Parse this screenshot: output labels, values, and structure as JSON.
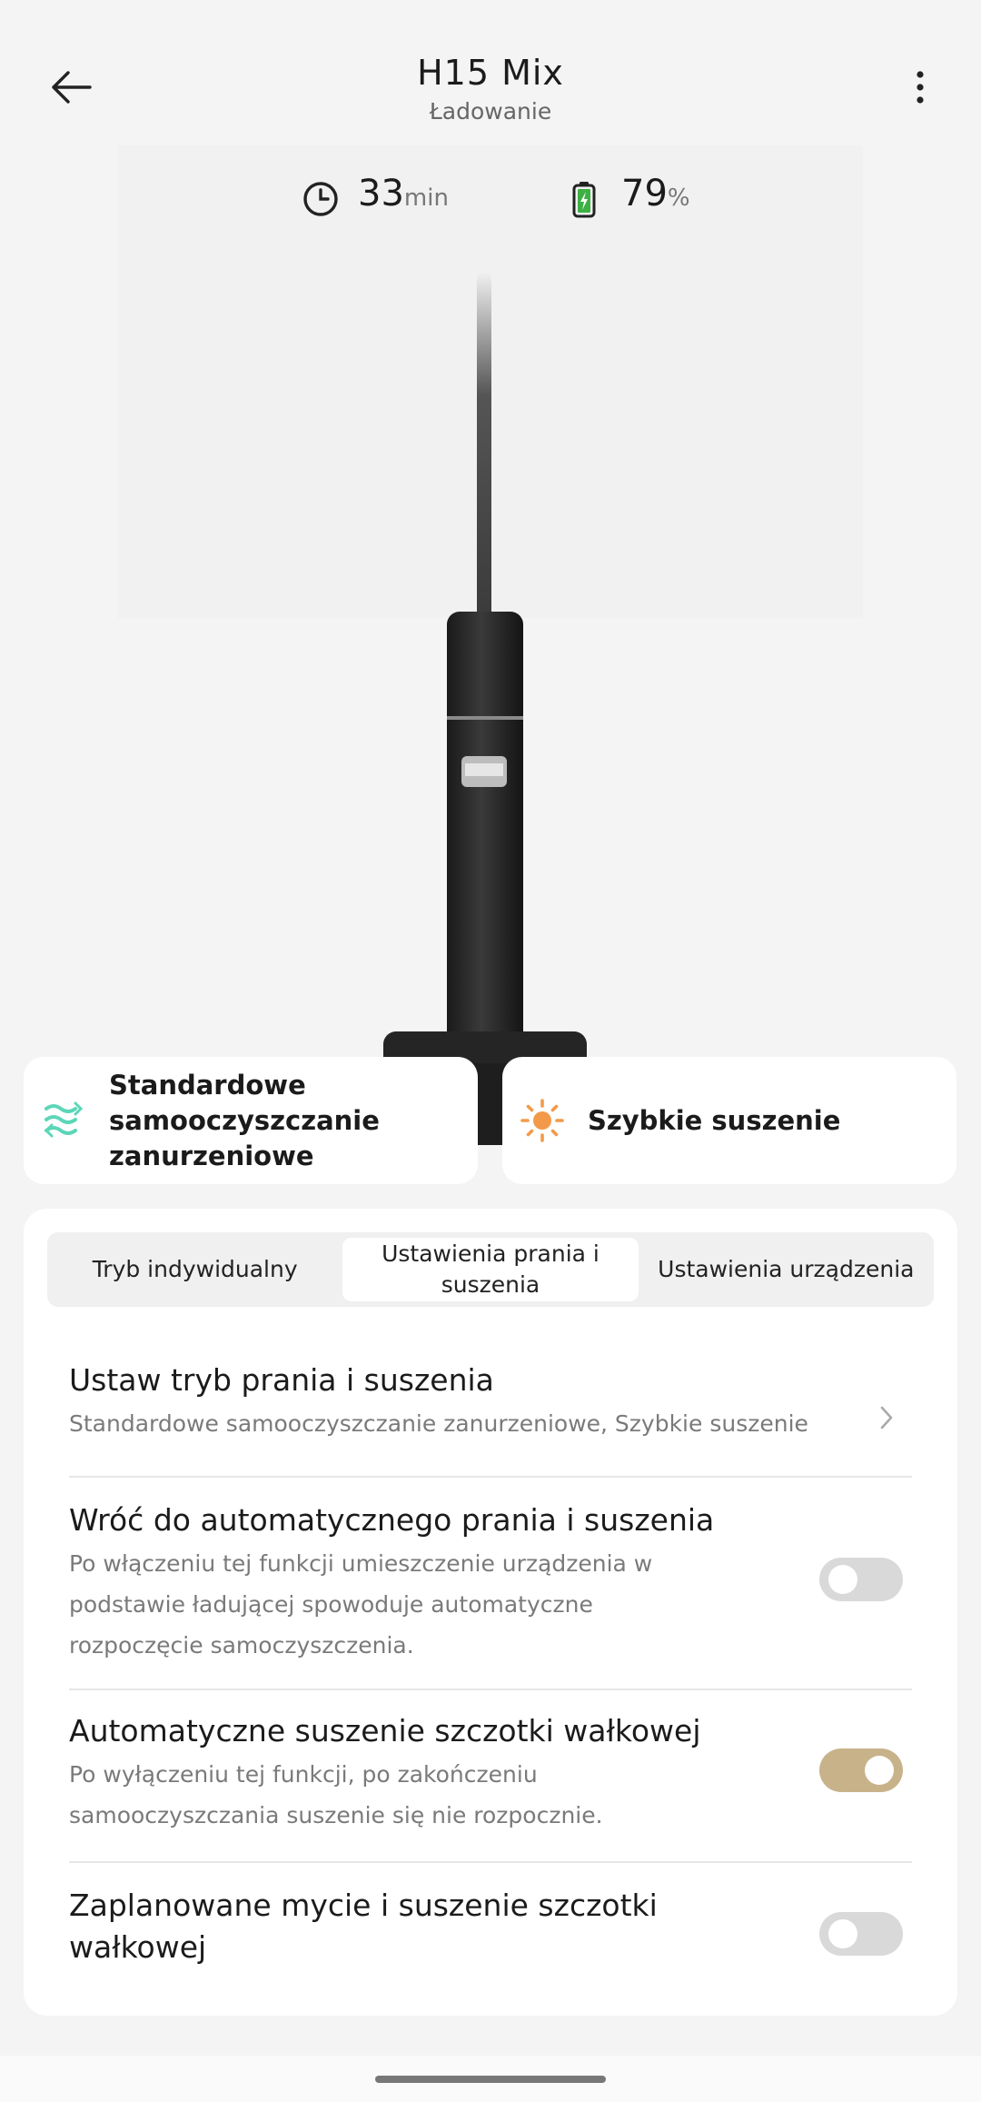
{
  "header": {
    "title": "H15 Mix",
    "status": "Ładowanie",
    "back_icon": "arrow-left-icon",
    "more_icon": "more-vertical-icon"
  },
  "stats": {
    "time_value": "33",
    "time_unit": "min",
    "battery_value": "79",
    "battery_unit": "%",
    "battery_color": "#3cb043"
  },
  "modes": {
    "left": {
      "label": "Standardowe samooczyszczanie zanurzeniowe",
      "icon": "self-clean-wave-icon",
      "color": "#5cd6b8"
    },
    "right": {
      "label": "Szybkie suszenie",
      "icon": "sun-icon",
      "color": "#f29a4a"
    }
  },
  "tabs": [
    {
      "label": "Tryb indywidualny",
      "active": false
    },
    {
      "label": "Ustawienia prania i suszenia",
      "active": true
    },
    {
      "label": "Ustawienia urządzenia",
      "active": false
    }
  ],
  "settings": {
    "wash_mode": {
      "title": "Ustaw tryb prania i suszenia",
      "desc": "Standardowe samooczyszczanie zanurzeniowe, Szybkie suszenie"
    },
    "auto_wash": {
      "title": "Wróć do automatycznego prania i suszenia",
      "desc": "Po włączeniu tej funkcji umieszczenie urządzenia w podstawie ładującej spowoduje automatyczne rozpoczęcie samoczyszczenia.",
      "enabled": false
    },
    "auto_dry": {
      "title": "Automatyczne suszenie szczotki wałkowej",
      "desc": "Po wyłączeniu tej funkcji, po zakończeniu samooczyszczania suszenie się nie rozpocznie.",
      "enabled": true
    },
    "scheduled": {
      "title": "Zaplanowane mycie i suszenie szczotki wałkowej",
      "enabled": false
    }
  },
  "accent_color": "#c8b28a"
}
